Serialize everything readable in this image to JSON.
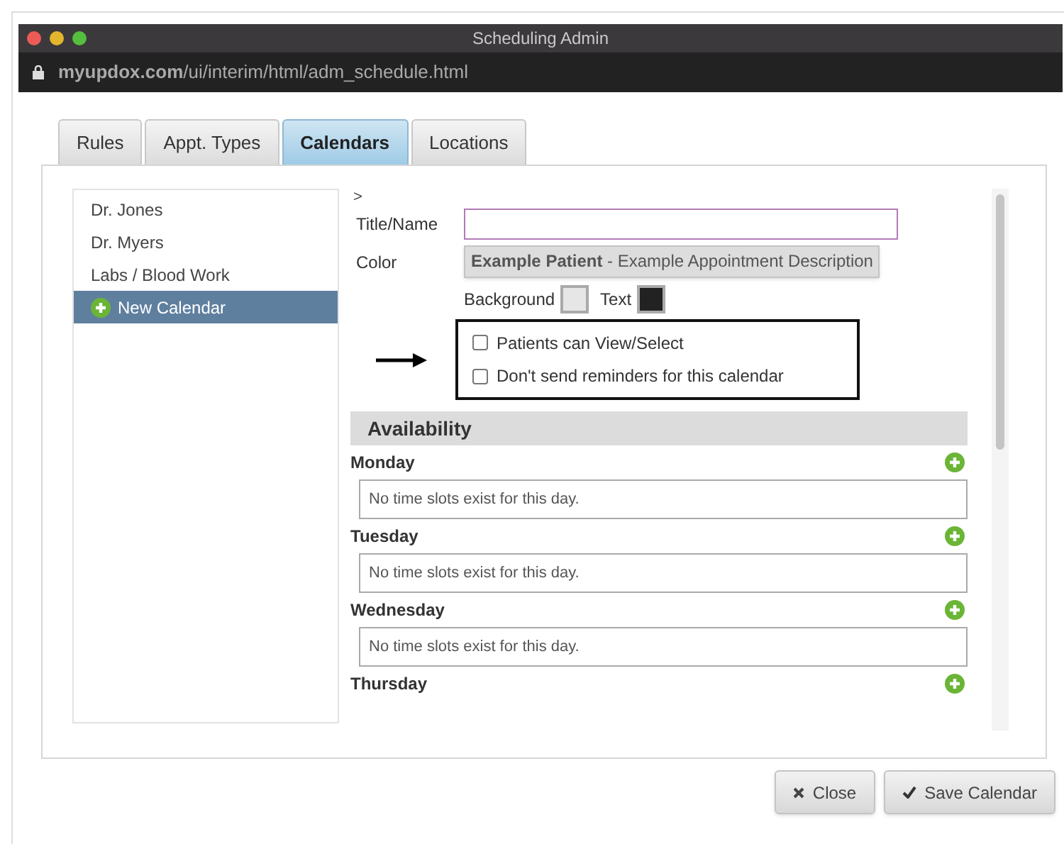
{
  "window": {
    "title": "Scheduling Admin",
    "url": "**myupdox.com**/ui/interim/html/adm_schedule.html"
  },
  "tabs": [
    {
      "label": "Rules",
      "selected": false
    },
    {
      "label": "Appt. Types",
      "selected": false
    },
    {
      "label": "Calendars",
      "selected": true
    },
    {
      "label": "Locations",
      "selected": false
    }
  ],
  "calendars": [
    {
      "label": "Dr. Jones",
      "kind": "item",
      "selected": false
    },
    {
      "label": "Dr. Myers",
      "kind": "item",
      "selected": false
    },
    {
      "label": "Labs / Blood Work",
      "kind": "item",
      "selected": false
    },
    {
      "label": "New Calendar",
      "kind": "new",
      "selected": true
    }
  ],
  "form": {
    "breadcrumb": ">",
    "title_label": "Title/Name",
    "color_label": "Color",
    "preview": "**Example Patient** - Example Appointment Description",
    "swatches": [
      {
        "label": "Background",
        "color": "#e6e6e6"
      },
      {
        "label": "Text",
        "color": "#222222"
      }
    ],
    "options": [
      {
        "label": "Patients can View/Select",
        "checked": false
      },
      {
        "label": "Don't send reminders for this calendar",
        "checked": false
      }
    ]
  },
  "availability": {
    "title": "Availability",
    "days": [
      {
        "name": "Monday",
        "message": "No time slots exist for this day."
      },
      {
        "name": "Tuesday",
        "message": "No time slots exist for this day."
      },
      {
        "name": "Wednesday",
        "message": "No time slots exist for this day."
      },
      {
        "name": "Thursday"
      }
    ]
  },
  "buttons": [
    {
      "label": "Close",
      "kind": "close"
    },
    {
      "label": "Save Calendar",
      "kind": "save"
    }
  ]
}
